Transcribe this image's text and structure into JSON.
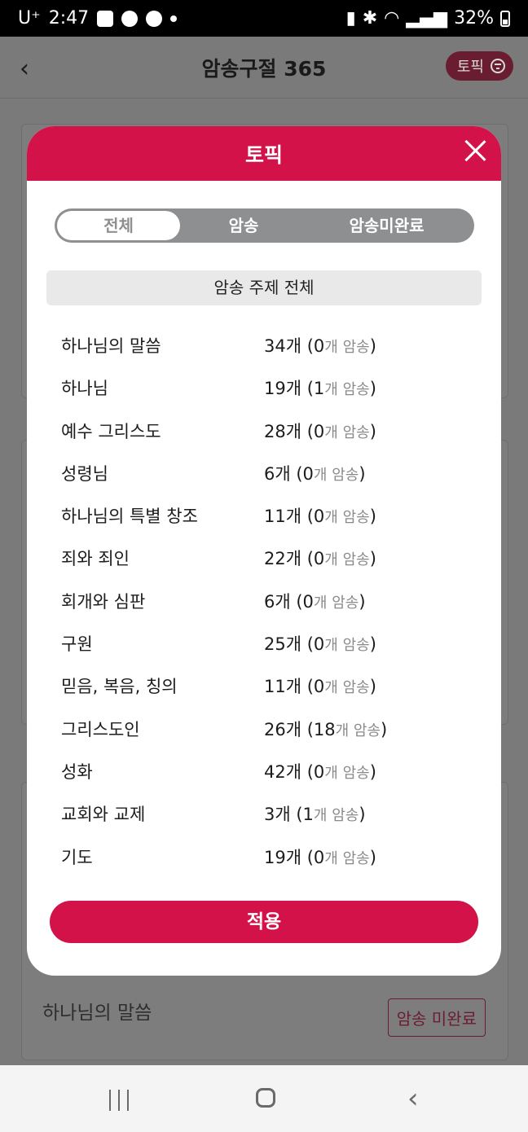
{
  "status_bar": {
    "carrier": "U⁺",
    "time": "2:47",
    "battery": "32%",
    "icons": [
      "image-icon",
      "talk-icon",
      "chrome-icon",
      "dot-icon",
      "battery-saver-icon",
      "bluetooth-icon",
      "wifi-icon",
      "signal-icon",
      "battery-icon"
    ]
  },
  "app_bar": {
    "title": "암송구절 365",
    "topic_button_label": "토픽"
  },
  "background": {
    "card_title": "하나님의 말씀",
    "card_badge": "암송 미완료"
  },
  "modal": {
    "title": "토픽",
    "tabs": [
      {
        "label": "전체",
        "active": true
      },
      {
        "label": "암송",
        "active": false
      },
      {
        "label": "암송미완료",
        "active": false
      }
    ],
    "all_topics_label": "암송 주제 전체",
    "topics": [
      {
        "name": "하나님의 말씀",
        "count": "34개 (0",
        "suffix": "개 암송",
        "close": ")"
      },
      {
        "name": "하나님",
        "count": "19개 (1",
        "suffix": "개 암송",
        "close": ")"
      },
      {
        "name": "예수 그리스도",
        "count": "28개 (0",
        "suffix": "개 암송",
        "close": ")"
      },
      {
        "name": "성령님",
        "count": "6개 (0",
        "suffix": "개 암송",
        "close": ")"
      },
      {
        "name": "하나님의 특별 창조",
        "count": "11개 (0",
        "suffix": "개 암송",
        "close": ")"
      },
      {
        "name": "죄와 죄인",
        "count": "22개 (0",
        "suffix": "개 암송",
        "close": ")"
      },
      {
        "name": "회개와 심판",
        "count": "6개 (0",
        "suffix": "개 암송",
        "close": ")"
      },
      {
        "name": "구원",
        "count": "25개 (0",
        "suffix": "개 암송",
        "close": ")"
      },
      {
        "name": "믿음, 복음, 칭의",
        "count": "11개 (0",
        "suffix": "개 암송",
        "close": ")"
      },
      {
        "name": "그리스도인",
        "count": "26개 (18",
        "suffix": "개 암송",
        "close": ")"
      },
      {
        "name": "성화",
        "count": "42개 (0",
        "suffix": "개 암송",
        "close": ")"
      },
      {
        "name": "교회와 교제",
        "count": "3개 (1",
        "suffix": "개 암송",
        "close": ")"
      },
      {
        "name": "기도",
        "count": "19개 (0",
        "suffix": "개 암송",
        "close": ")"
      }
    ],
    "apply_label": "적용"
  },
  "colors": {
    "accent": "#d3124a",
    "segment_bg": "#8e8f91"
  }
}
